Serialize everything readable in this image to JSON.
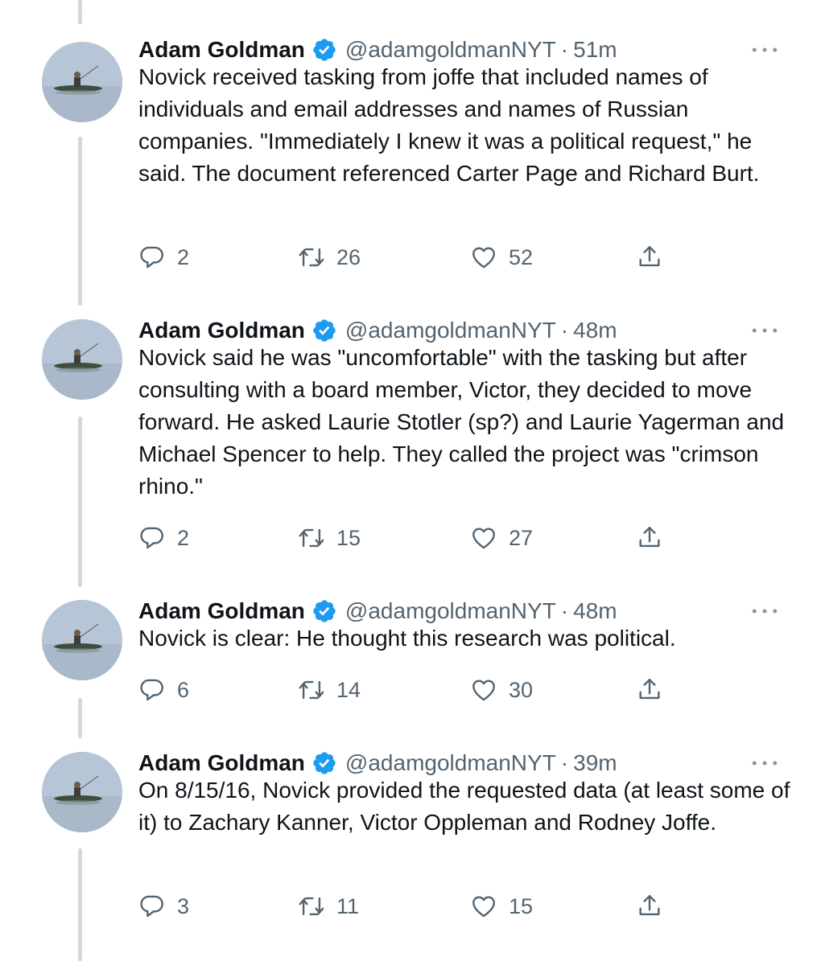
{
  "tweets": [
    {
      "name": "Adam Goldman",
      "handle": "@adamgoldmanNYT",
      "separator": "·",
      "time": "51m",
      "text": "Novick received tasking from joffe that included names of individuals and email addresses and names of Russian companies. \"Immediately I knew it was a political request,\" he said. The document referenced Carter Page and Richard Burt.",
      "replies": "2",
      "retweets": "26",
      "likes": "52"
    },
    {
      "name": "Adam Goldman",
      "handle": "@adamgoldmanNYT",
      "separator": "·",
      "time": "48m",
      "text": "Novick said he was \"uncomfortable\" with the tasking but after consulting with a board member, Victor, they decided to move forward. He asked Laurie Stotler (sp?) and Laurie Yagerman and Michael Spencer to help. They called the project was \"crimson rhino.\"",
      "replies": "2",
      "retweets": "15",
      "likes": "27"
    },
    {
      "name": "Adam Goldman",
      "handle": "@adamgoldmanNYT",
      "separator": "·",
      "time": "48m",
      "text": "Novick is clear: He thought this research was political.",
      "replies": "6",
      "retweets": "14",
      "likes": "30"
    },
    {
      "name": "Adam Goldman",
      "handle": "@adamgoldmanNYT",
      "separator": "·",
      "time": "39m",
      "text": "On 8/15/16, Novick provided the requested data (at least some of it) to Zachary Kanner, Victor Oppleman and Rodney Joffe.",
      "replies": "3",
      "retweets": "11",
      "likes": "15"
    }
  ],
  "icons": {
    "verified": "verified-badge-icon",
    "more": "more-options-icon",
    "reply": "reply-icon",
    "retweet": "retweet-icon",
    "like": "heart-icon",
    "share": "share-icon"
  },
  "colors": {
    "accent": "#1d9bf0",
    "text": "#0f1419",
    "secondary": "#536471",
    "thread_line": "#cfd9de"
  }
}
